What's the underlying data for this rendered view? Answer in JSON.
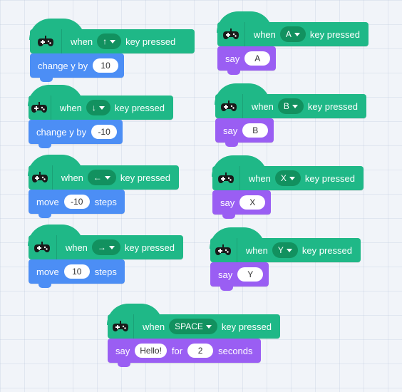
{
  "common": {
    "when": "when",
    "key_pressed": "key pressed",
    "change_y_by": "change y by",
    "move": "move",
    "steps": "steps",
    "say": "say",
    "for": "for",
    "seconds": "seconds"
  },
  "colors": {
    "event": "#1fb887",
    "event_dropdown": "#12915f",
    "motion": "#4c8ef5",
    "looks": "#9a5ef3"
  },
  "icons": {
    "hat": "gamepad-icon"
  },
  "scripts": {
    "up": {
      "key": "↑",
      "value": "10"
    },
    "down": {
      "key": "↓",
      "value": "-10"
    },
    "left": {
      "key": "←",
      "value": "-10"
    },
    "right": {
      "key": "→",
      "value": "10"
    },
    "a": {
      "key": "A",
      "say": "A"
    },
    "b": {
      "key": "B",
      "say": "B"
    },
    "x": {
      "key": "X",
      "say": "X"
    },
    "y": {
      "key": "Y",
      "say": "Y"
    },
    "space": {
      "key": "SPACE",
      "say": "Hello!",
      "secs": "2"
    }
  }
}
